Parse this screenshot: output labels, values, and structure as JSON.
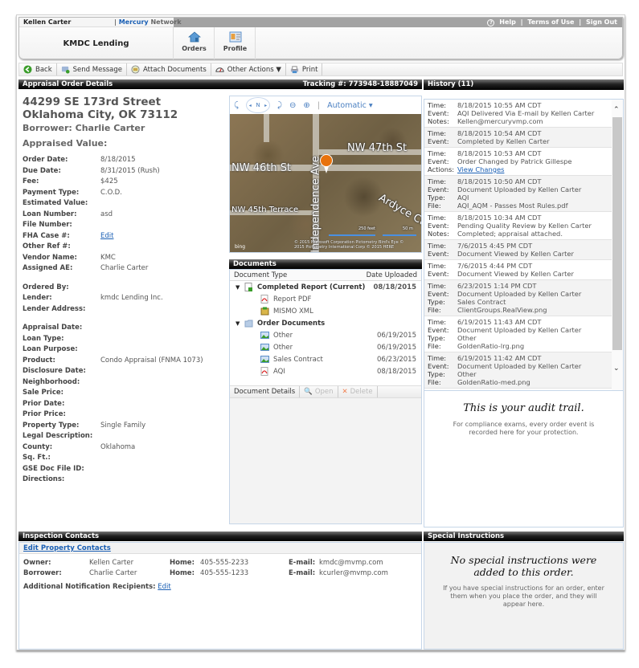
{
  "header": {
    "user_name": "Kellen Carter",
    "network_brand": "Mercury",
    "network_suffix": "Network",
    "company": "KMDC Lending",
    "help_label": "Help",
    "terms_label": "Terms of Use",
    "signout_label": "Sign Out",
    "nav": [
      {
        "label": "Orders",
        "icon": "house-icon"
      },
      {
        "label": "Profile",
        "icon": "id-card-icon"
      }
    ]
  },
  "toolbar": {
    "back_label": "Back",
    "send_message_label": "Send Message",
    "attach_label": "Attach Documents",
    "other_actions_label": "Other Actions ▼",
    "print_label": "Print"
  },
  "details": {
    "panel_title": "Appraisal Order Details",
    "tracking": "Tracking #: 773948-18887049",
    "address_line1": "44299 SE 173rd Street",
    "address_line2": "Oklahoma City, OK 73112",
    "borrower_line": "Borrower: Charlie Carter",
    "appraised_value_line": "Appraised Value:",
    "fields_group1": [
      {
        "label": "Order Date:",
        "value": "8/18/2015"
      },
      {
        "label": "Due Date:",
        "value": "8/31/2015 (Rush)"
      },
      {
        "label": "Fee:",
        "value": "$425"
      },
      {
        "label": "Payment Type:",
        "value": "C.O.D."
      },
      {
        "label": "Estimated Value:",
        "value": ""
      },
      {
        "label": "Loan Number:",
        "value": "asd"
      },
      {
        "label": "File Number:",
        "value": ""
      },
      {
        "label": "FHA Case #:",
        "value": "Edit",
        "link": true
      },
      {
        "label": "Other Ref #:",
        "value": ""
      },
      {
        "label": "Vendor Name:",
        "value": "KMC"
      },
      {
        "label": "Assigned AE:",
        "value": "Charlie Carter"
      }
    ],
    "fields_group2": [
      {
        "label": "Ordered By:",
        "value": ""
      },
      {
        "label": "Lender:",
        "value": "kmdc Lending Inc."
      },
      {
        "label": "Lender Address:",
        "value": ""
      }
    ],
    "fields_group3": [
      {
        "label": "Appraisal Date:",
        "value": ""
      },
      {
        "label": "Loan Type:",
        "value": ""
      },
      {
        "label": "Loan Purpose:",
        "value": ""
      },
      {
        "label": "Product:",
        "value": "Condo Appraisal (FNMA 1073)"
      },
      {
        "label": "Disclosure Date:",
        "value": ""
      },
      {
        "label": "Neighborhood:",
        "value": ""
      },
      {
        "label": "Sale Price:",
        "value": ""
      },
      {
        "label": "Prior Date:",
        "value": ""
      },
      {
        "label": "Prior Price:",
        "value": ""
      },
      {
        "label": "Property Type:",
        "value": "Single Family"
      },
      {
        "label": "Legal Description:",
        "value": ""
      },
      {
        "label": "County:",
        "value": "Oklahoma"
      },
      {
        "label": "Sq. Ft.:",
        "value": ""
      },
      {
        "label": "GSE Doc File ID:",
        "value": ""
      },
      {
        "label": "Directions:",
        "value": ""
      }
    ]
  },
  "map": {
    "compass_label": "N",
    "mode_label": "Automatic ▾",
    "streets": [
      "NW 47th St",
      "NW 46th St",
      "NW 45th Terrace",
      "Independence Ave",
      "Ardyce Ct"
    ],
    "scale_feet": "250 feet",
    "scale_meters": "50 m",
    "copyright": "© 2015 Microsoft Corporation  Pictometry Bird's Eye © 2015 Pictometry International Corp  © 2015 HERE",
    "provider": "bing"
  },
  "documents": {
    "panel_title": "Documents",
    "col_type": "Document Type",
    "col_date": "Date Uploaded",
    "groups": [
      {
        "name": "Completed Report (Current)",
        "date": "08/18/2015",
        "items": [
          {
            "name": "Report PDF",
            "date": "",
            "icon": "pdf-icon"
          },
          {
            "name": "MISMO XML",
            "date": "",
            "icon": "xml-icon"
          }
        ]
      },
      {
        "name": "Order Documents",
        "date": "",
        "items": [
          {
            "name": "Other",
            "date": "06/19/2015",
            "icon": "image-icon"
          },
          {
            "name": "Other",
            "date": "06/19/2015",
            "icon": "image-icon"
          },
          {
            "name": "Sales Contract",
            "date": "06/23/2015",
            "icon": "image-icon"
          },
          {
            "name": "AQI",
            "date": "08/18/2015",
            "icon": "pdf-icon"
          }
        ]
      }
    ],
    "details_label": "Document Details",
    "open_label": "Open",
    "delete_label": "Delete"
  },
  "history": {
    "panel_title": "History (11)",
    "items": [
      {
        "rows": [
          [
            "Time:",
            "8/18/2015 10:55 AM CDT"
          ],
          [
            "Event:",
            "AQI Delivered Via E-mail by Kellen Carter"
          ],
          [
            "Notes:",
            "Kellen@mercuryvmp.com"
          ]
        ]
      },
      {
        "rows": [
          [
            "Time:",
            "8/18/2015 10:54 AM CDT"
          ],
          [
            "Event:",
            "Completed by Kellen Carter"
          ]
        ]
      },
      {
        "rows": [
          [
            "Time:",
            "8/18/2015 10:53 AM CDT"
          ],
          [
            "Event:",
            "Order Changed by Patrick Gillespe"
          ],
          [
            "Actions:",
            "View Changes"
          ]
        ],
        "link_row": 2
      },
      {
        "rows": [
          [
            "Time:",
            "8/18/2015 10:50 AM CDT"
          ],
          [
            "Event:",
            "Document Uploaded by Kellen Carter"
          ],
          [
            "Type:",
            "AQI"
          ],
          [
            "File:",
            "AQI_AQM - Passes Most Rules.pdf"
          ]
        ]
      },
      {
        "rows": [
          [
            "Time:",
            "8/18/2015 10:34 AM CDT"
          ],
          [
            "Event:",
            "Pending Quality Review by Kellen Carter"
          ],
          [
            "Notes:",
            "Completed; appraisal attached."
          ]
        ]
      },
      {
        "rows": [
          [
            "Time:",
            "7/6/2015 4:45 PM CDT"
          ],
          [
            "Event:",
            "Document Viewed by Kellen Carter"
          ]
        ]
      },
      {
        "rows": [
          [
            "Time:",
            "7/6/2015 4:44 PM CDT"
          ],
          [
            "Event:",
            "Document Viewed by Kellen Carter"
          ]
        ]
      },
      {
        "rows": [
          [
            "Time:",
            "6/23/2015 1:14 PM CDT"
          ],
          [
            "Event:",
            "Document Uploaded by Kellen Carter"
          ],
          [
            "Type:",
            "Sales Contract"
          ],
          [
            "File:",
            "ClientGroups.RealView.png"
          ]
        ]
      },
      {
        "rows": [
          [
            "Time:",
            "6/19/2015 11:43 AM CDT"
          ],
          [
            "Event:",
            "Document Uploaded by Kellen Carter"
          ],
          [
            "Type:",
            "Other"
          ],
          [
            "File:",
            "GoldenRatio-lrg.png"
          ]
        ]
      },
      {
        "rows": [
          [
            "Time:",
            "6/19/2015 11:42 AM CDT"
          ],
          [
            "Event:",
            "Document Uploaded by Kellen Carter"
          ],
          [
            "Type:",
            "Other"
          ],
          [
            "File:",
            "GoldenRatio-med.png"
          ]
        ]
      }
    ],
    "audit_title": "This is your audit trail.",
    "audit_text": "For compliance exams, every order event is recorded here for your protection."
  },
  "inspection": {
    "panel_title": "Inspection Contacts",
    "edit_link": "Edit Property Contacts",
    "contacts": [
      {
        "role": "Owner:",
        "name": "Kellen Carter",
        "home_label": "Home:",
        "home": "405-555-2233",
        "email_label": "E-mail:",
        "email": "kmdc@mvmp.com"
      },
      {
        "role": "Borrower:",
        "name": "Charlie Carter",
        "home_label": "Home:",
        "home": "405-555-1233",
        "email_label": "E-mail:",
        "email": "kcurler@mvmp.com"
      }
    ],
    "additional_label": "Additional Notification Recipients:",
    "additional_edit": "Edit"
  },
  "special": {
    "panel_title": "Special Instructions",
    "title": "No special instructions were added to this order.",
    "text": "If you have special instructions for an order, enter them when you place the order, and they will appear here."
  }
}
